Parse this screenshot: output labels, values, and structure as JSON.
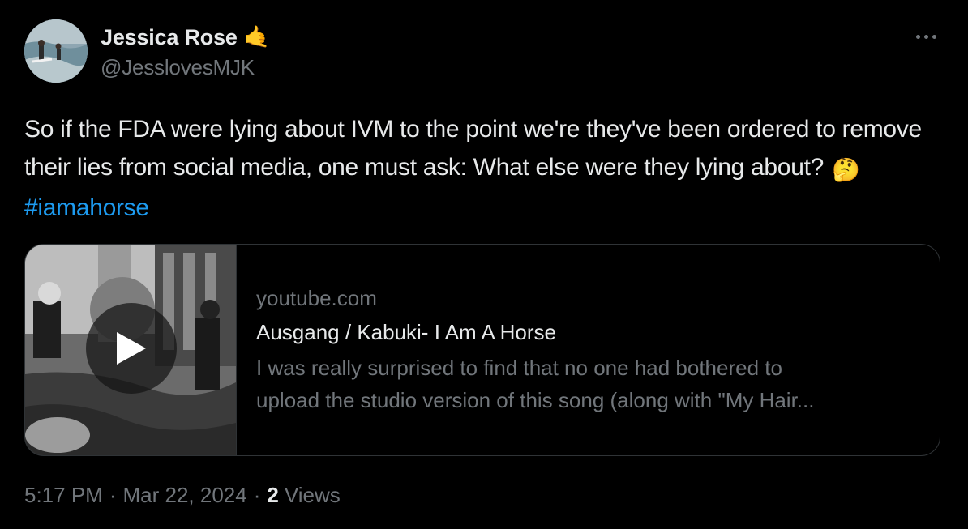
{
  "author": {
    "display_name": "Jessica Rose",
    "name_emoji": "🤙",
    "handle": "@JesslovesMJK"
  },
  "more_icon": "more-horizontal-icon",
  "tweet": {
    "text": "So if the FDA were lying about IVM to the point we're they've been ordered to remove their lies from social media, one must ask: What else were they lying about?",
    "emoji": "🤔",
    "hashtag": "#iamahorse"
  },
  "link_card": {
    "domain": "youtube.com",
    "title": "Ausgang / Kabuki- I Am A Horse",
    "description_line1": "I was really surprised to find that no one had bothered to",
    "description_line2": "upload the studio version of this song (along with \"My Hair...",
    "play_icon": "play-icon"
  },
  "meta": {
    "time": "5:17 PM",
    "separator": "·",
    "date": "Mar 22, 2024",
    "views_count": "2",
    "views_label": "Views"
  },
  "colors": {
    "background": "#000000",
    "text": "#e7e9ea",
    "secondary_text": "#71767b",
    "link": "#1d9bf0",
    "border": "#2f3336"
  }
}
